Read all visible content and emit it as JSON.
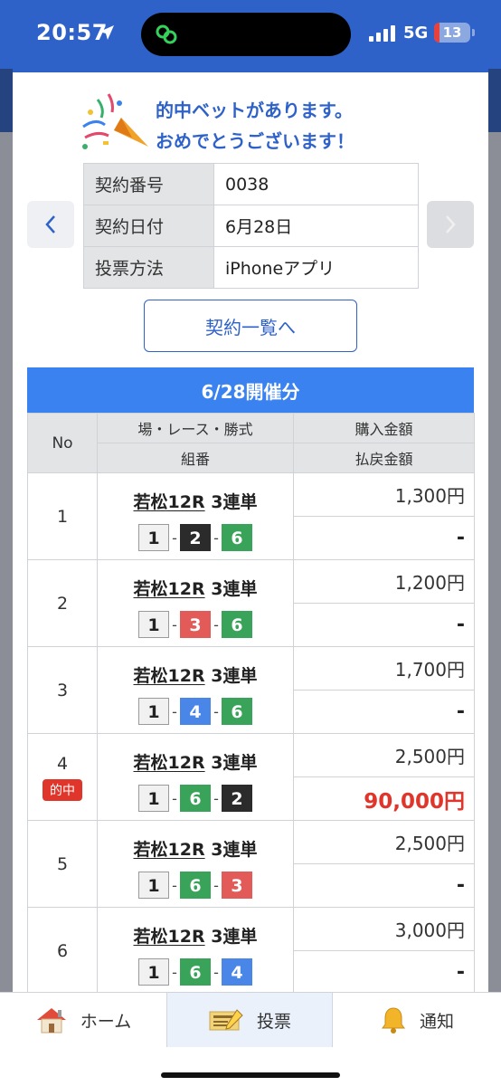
{
  "status": {
    "time": "20:57",
    "network": "5G",
    "battery": "13",
    "battery_color": "#e8403a"
  },
  "banner": {
    "line1": "的中ベットがあります。",
    "line2": "おめでとうございます！"
  },
  "contract": {
    "rows": [
      {
        "label": "契約番号",
        "value": "0038"
      },
      {
        "label": "契約日付",
        "value": "6月28日"
      },
      {
        "label": "投票方法",
        "value": "iPhoneアプリ"
      }
    ],
    "list_button": "契約一覧へ"
  },
  "day_header": "6/28開催分",
  "table_headers": {
    "no": "No",
    "race": "場・レース・勝式",
    "combo": "組番",
    "amount": "購入金額",
    "payout": "払戻金額"
  },
  "bets": [
    {
      "no": "1",
      "venue": "若松12R",
      "type": "3連単",
      "combo": [
        {
          "n": "1",
          "color": "white"
        },
        {
          "n": "2",
          "color": "black"
        },
        {
          "n": "6",
          "color": "green"
        }
      ],
      "amount": "1,300円",
      "payout": "-",
      "hit": false
    },
    {
      "no": "2",
      "venue": "若松12R",
      "type": "3連単",
      "combo": [
        {
          "n": "1",
          "color": "white"
        },
        {
          "n": "3",
          "color": "red"
        },
        {
          "n": "6",
          "color": "green"
        }
      ],
      "amount": "1,200円",
      "payout": "-",
      "hit": false
    },
    {
      "no": "3",
      "venue": "若松12R",
      "type": "3連単",
      "combo": [
        {
          "n": "1",
          "color": "white"
        },
        {
          "n": "4",
          "color": "blue"
        },
        {
          "n": "6",
          "color": "green"
        }
      ],
      "amount": "1,700円",
      "payout": "-",
      "hit": false
    },
    {
      "no": "4",
      "venue": "若松12R",
      "type": "3連単",
      "combo": [
        {
          "n": "1",
          "color": "white"
        },
        {
          "n": "6",
          "color": "green"
        },
        {
          "n": "2",
          "color": "black"
        }
      ],
      "amount": "2,500円",
      "payout": "90,000円",
      "hit": true,
      "hit_label": "的中"
    },
    {
      "no": "5",
      "venue": "若松12R",
      "type": "3連単",
      "combo": [
        {
          "n": "1",
          "color": "white"
        },
        {
          "n": "6",
          "color": "green"
        },
        {
          "n": "3",
          "color": "red"
        }
      ],
      "amount": "2,500円",
      "payout": "-",
      "hit": false
    },
    {
      "no": "6",
      "venue": "若松12R",
      "type": "3連単",
      "combo": [
        {
          "n": "1",
          "color": "white"
        },
        {
          "n": "6",
          "color": "green"
        },
        {
          "n": "4",
          "color": "blue"
        }
      ],
      "amount": "3,000円",
      "payout": "-",
      "hit": false
    }
  ],
  "chip_colors": {
    "white": {
      "bg": "#f1f1f1",
      "fg": "#222",
      "border": "#9a9a9a"
    },
    "black": {
      "bg": "#2b2b2b",
      "fg": "#ffffff",
      "border": "#2b2b2b"
    },
    "red": {
      "bg": "#e25b58",
      "fg": "#ffffff",
      "border": "#e25b58"
    },
    "blue": {
      "bg": "#4a86e8",
      "fg": "#ffffff",
      "border": "#4a86e8"
    },
    "green": {
      "bg": "#3aa35a",
      "fg": "#ffffff",
      "border": "#3aa35a"
    }
  },
  "tabs": {
    "home": "ホーム",
    "vote": "投票",
    "notice": "通知"
  },
  "icons": {
    "prev": "chevron-left-icon",
    "next": "chevron-right-icon",
    "home": "home-icon",
    "vote": "ticket-icon",
    "notice": "bell-icon"
  }
}
